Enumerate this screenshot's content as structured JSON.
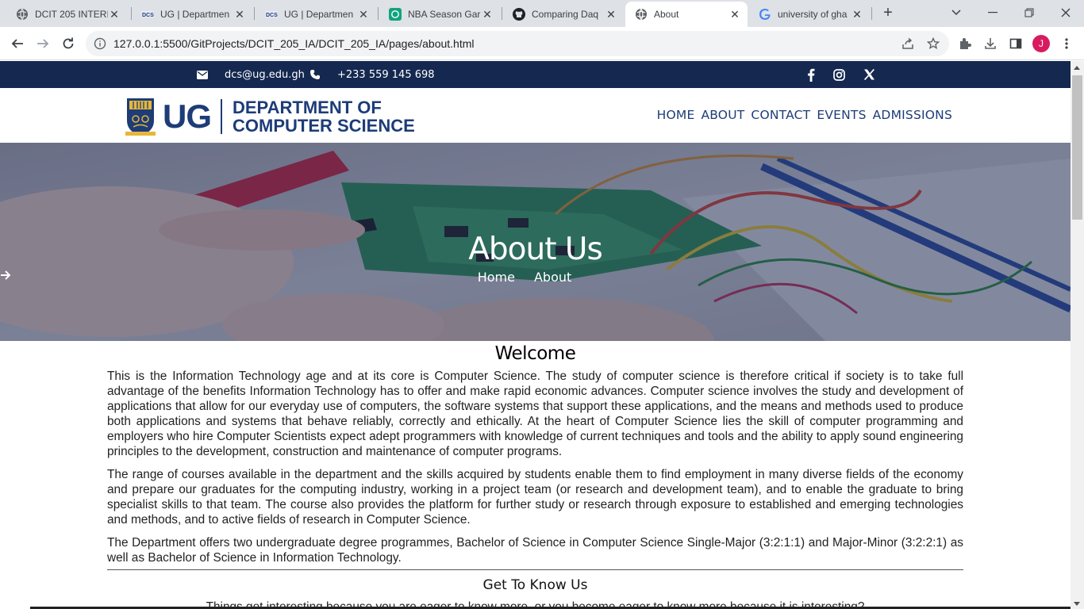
{
  "browser": {
    "tabs": [
      {
        "title": "DCIT 205 INTERI",
        "icon": "globe-icon",
        "active": false
      },
      {
        "title": "UG | Departmen",
        "icon": "ug-favicon",
        "active": false
      },
      {
        "title": "UG | Departmen",
        "icon": "ug-favicon",
        "active": false
      },
      {
        "title": "NBA Season Gar",
        "icon": "openai-icon",
        "active": false
      },
      {
        "title": "Comparing Daq",
        "icon": "github-icon",
        "active": false
      },
      {
        "title": "About",
        "icon": "globe-icon",
        "active": true
      },
      {
        "title": "university of gha",
        "icon": "google-icon",
        "active": false
      }
    ],
    "url": "127.0.0.1:5500/GitProjects/DCIT_205_IA/DCIT_205_IA/pages/about.html",
    "avatar_letter": "J",
    "avatar_color": "#d81b60"
  },
  "topbar": {
    "email": "dcs@ug.edu.gh",
    "phone": "+233 559 145 698",
    "social": [
      "facebook-icon",
      "instagram-icon",
      "x-icon"
    ],
    "background": "#142850"
  },
  "header": {
    "logo_mark": "UG",
    "logo_line1": "DEPARTMENT OF",
    "logo_line2": "COMPUTER SCIENCE",
    "brand_color": "#1d3c78",
    "nav": [
      "HOME",
      "ABOUT",
      "CONTACT",
      "EVENTS",
      "ADMISSIONS"
    ]
  },
  "hero": {
    "title": "About Us",
    "crumb_home": "Home",
    "crumb_current": "About"
  },
  "main": {
    "heading": "Welcome",
    "paragraphs": [
      "This is the Information Technology age and at its core is Computer Science. The study of computer science is therefore critical if society is to take full advantage of the benefits Information Technology has to offer and make rapid economic advances. Computer science involves the study and development of applications that allow for our everyday use of computers, the software systems that support these applications, and the means and methods used to produce both applications and systems that behave reliably, correctly and ethically. At the heart of Computer Science lies the skill of computer programming and employers who hire Computer Scientists expect adept programmers with knowledge of current techniques and tools and the ability to apply sound engineering principles to the development, construction and maintenance of computer programs.",
      "The range of courses available in the department and the skills acquired by students enable them to find employment in many diverse fields of the economy and prepare our graduates for the computing industry, working in a project team (or research and development team), and to enable the graduate to bring specialist skills to that team. The course also provides the platform for further study or research through exposure to established and emerging technologies and methods, and to active fields of research in Computer Science.",
      "The Department offers two undergraduate degree programmes, Bachelor of Science in Computer Science Single-Major (3:2:1:1) and Major-Minor (3:2:2:1) as well as Bachelor of Science in Information Technology."
    ],
    "subheading": "Get To Know Us",
    "tagline": "Things get interesting because you are eager to know more, or you become eager to know more because it is interesting?"
  }
}
